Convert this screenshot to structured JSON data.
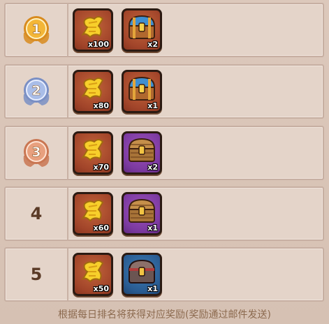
{
  "colors": {
    "gold_medal": "#e6a12a",
    "silver_medal": "#8ea6d6",
    "bronze_medal": "#d98a62",
    "red_tile": "#a2452a",
    "purple_tile": "#7c3aa0",
    "blue_tile": "#2a5c92",
    "rank_text": "#5a3a26",
    "footer_text": "#8c6a4f"
  },
  "ranks": [
    {
      "rank": "1",
      "medal": "gold",
      "rewards": [
        {
          "icon": "gold-scroll-icon",
          "tile": "red",
          "qty": "x100"
        },
        {
          "icon": "blue-chest-icon",
          "tile": "red",
          "qty": "x2"
        }
      ]
    },
    {
      "rank": "2",
      "medal": "silver",
      "rewards": [
        {
          "icon": "gold-scroll-icon",
          "tile": "red",
          "qty": "x80"
        },
        {
          "icon": "blue-chest-icon",
          "tile": "red",
          "qty": "x1"
        }
      ]
    },
    {
      "rank": "3",
      "medal": "bronze",
      "rewards": [
        {
          "icon": "gold-scroll-icon",
          "tile": "red",
          "qty": "x70"
        },
        {
          "icon": "wooden-chest-icon",
          "tile": "purple",
          "qty": "x2"
        }
      ]
    },
    {
      "rank": "4",
      "medal": "none",
      "rewards": [
        {
          "icon": "gold-scroll-icon",
          "tile": "red",
          "qty": "x60"
        },
        {
          "icon": "wooden-chest-icon",
          "tile": "purple",
          "qty": "x1"
        }
      ]
    },
    {
      "rank": "5",
      "medal": "none",
      "rewards": [
        {
          "icon": "gold-scroll-icon",
          "tile": "red",
          "qty": "x50"
        },
        {
          "icon": "iron-chest-icon",
          "tile": "blue",
          "qty": "x1"
        }
      ]
    }
  ],
  "footer": "根据每日排名将获得对应奖励(奖励通过邮件发送)"
}
